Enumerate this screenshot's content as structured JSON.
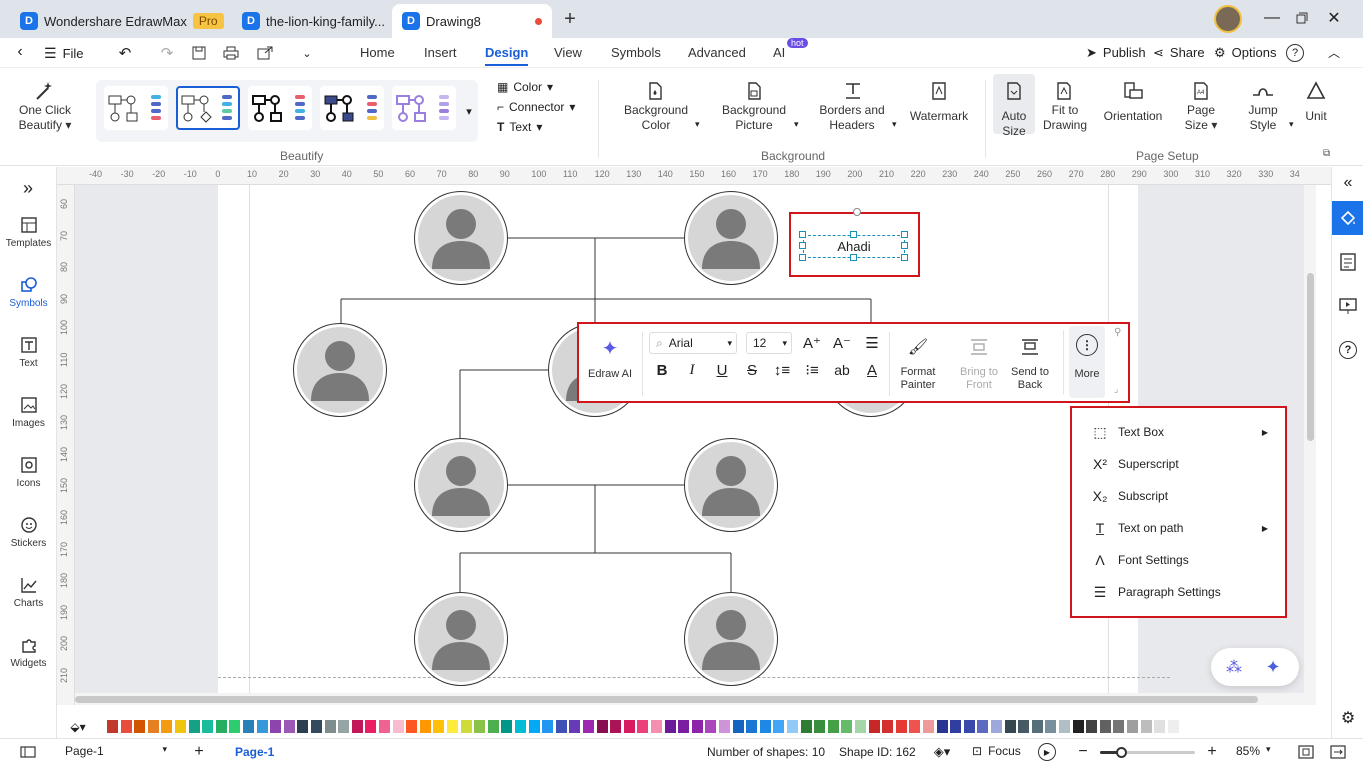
{
  "app": {
    "name": "Wondershare EdrawMax",
    "badge": "Pro"
  },
  "tabs": [
    {
      "label": "the-lion-king-family..."
    },
    {
      "label": "Drawing8"
    }
  ],
  "menu": {
    "file": "File",
    "items": [
      "Home",
      "Insert",
      "Design",
      "View",
      "Symbols",
      "Advanced",
      "AI"
    ],
    "active": "Design",
    "ai_badge": "hot",
    "publish": "Publish",
    "share": "Share",
    "options": "Options"
  },
  "ribbon": {
    "one_click": "One Click",
    "beautify": "Beautify",
    "group_beautify": "Beautify",
    "color": "Color",
    "connector": "Connector",
    "text": "Text",
    "bg_color_1": "Background",
    "bg_color_2": "Color",
    "bg_pic_1": "Background",
    "bg_pic_2": "Picture",
    "borders_1": "Borders and",
    "borders_2": "Headers",
    "watermark": "Watermark",
    "group_background": "Background",
    "auto_1": "Auto",
    "auto_2": "Size",
    "fit_1": "Fit to",
    "fit_2": "Drawing",
    "orientation": "Orientation",
    "page_1": "Page",
    "page_2": "Size",
    "jump_1": "Jump",
    "jump_2": "Style",
    "unit": "Unit",
    "group_page": "Page Setup"
  },
  "sidebar": [
    {
      "label": "Templates"
    },
    {
      "label": "Symbols"
    },
    {
      "label": "Text"
    },
    {
      "label": "Images"
    },
    {
      "label": "Icons"
    },
    {
      "label": "Stickers"
    },
    {
      "label": "Charts"
    },
    {
      "label": "Widgets"
    }
  ],
  "ruler_h": [
    "-40",
    "-30",
    "-20",
    "-10",
    "0",
    "10",
    "20",
    "30",
    "40",
    "50",
    "60",
    "70",
    "80",
    "90",
    "100",
    "110",
    "120",
    "130",
    "140",
    "150",
    "160",
    "170",
    "180",
    "190",
    "200",
    "210",
    "220",
    "230",
    "240",
    "250",
    "260",
    "270",
    "280",
    "290",
    "300",
    "310",
    "320",
    "330",
    "34"
  ],
  "ruler_v": [
    "60",
    "70",
    "80",
    "90",
    "100",
    "110",
    "120",
    "130",
    "140",
    "150",
    "160",
    "170",
    "180",
    "190",
    "200",
    "210"
  ],
  "selected_text": "Ahadi",
  "toolbar": {
    "edraw_ai": "Edraw AI",
    "font": "Arial",
    "size": "12",
    "format_1": "Format",
    "format_2": "Painter",
    "bring_1": "Bring to",
    "bring_2": "Front",
    "send_1": "Send to",
    "send_2": "Back",
    "more": "More"
  },
  "context_menu": [
    {
      "label": "Text Box",
      "icon": "text-box-icon",
      "submenu": true
    },
    {
      "label": "Superscript",
      "icon": "superscript-icon",
      "submenu": false
    },
    {
      "label": "Subscript",
      "icon": "subscript-icon",
      "submenu": false
    },
    {
      "label": "Text on path",
      "icon": "text-on-path-icon",
      "submenu": true
    },
    {
      "label": "Font Settings",
      "icon": "font-settings-icon",
      "submenu": false
    },
    {
      "label": "Paragraph Settings",
      "icon": "paragraph-settings-icon",
      "submenu": false
    }
  ],
  "status": {
    "page_select": "Page-1",
    "page_tab": "Page-1",
    "shapes": "Number of shapes: 10",
    "shape_id": "Shape ID: 162",
    "focus": "Focus",
    "zoom": "85%"
  },
  "colors": {
    "accent": "#1a5ed8",
    "highlight": "#d0161a",
    "palette": [
      "#c0392b",
      "#e74c3c",
      "#d35400",
      "#e67e22",
      "#f39c12",
      "#f1c40f",
      "#16a085",
      "#1abc9c",
      "#27ae60",
      "#2ecc71",
      "#2980b9",
      "#3498db",
      "#8e44ad",
      "#9b59b6",
      "#2c3e50",
      "#34495e",
      "#7f8c8d",
      "#95a5a6",
      "#c2185b",
      "#e91e63",
      "#f06292",
      "#f8bbd0",
      "#ff5722",
      "#ff9800",
      "#ffc107",
      "#ffeb3b",
      "#cddc39",
      "#8bc34a",
      "#4caf50",
      "#009688",
      "#00bcd4",
      "#03a9f4",
      "#2196f3",
      "#3f51b5",
      "#673ab7",
      "#9c27b0",
      "#880e4f",
      "#ad1457",
      "#d81b60",
      "#ec407a",
      "#f48fb1",
      "#6a1b9a",
      "#7b1fa2",
      "#8e24aa",
      "#ab47bc",
      "#ce93d8",
      "#1565c0",
      "#1976d2",
      "#1e88e5",
      "#42a5f5",
      "#90caf9",
      "#2e7d32",
      "#388e3c",
      "#43a047",
      "#66bb6a",
      "#a5d6a7",
      "#c62828",
      "#d32f2f",
      "#e53935",
      "#ef5350",
      "#ef9a9a",
      "#283593",
      "#303f9f",
      "#3949ab",
      "#5c6bc0",
      "#9fa8da",
      "#37474f",
      "#455a64",
      "#546e7a",
      "#78909c",
      "#b0bec5",
      "#212121",
      "#424242",
      "#616161",
      "#757575",
      "#9e9e9e",
      "#bdbdbd",
      "#e0e0e0",
      "#eeeeee"
    ]
  }
}
